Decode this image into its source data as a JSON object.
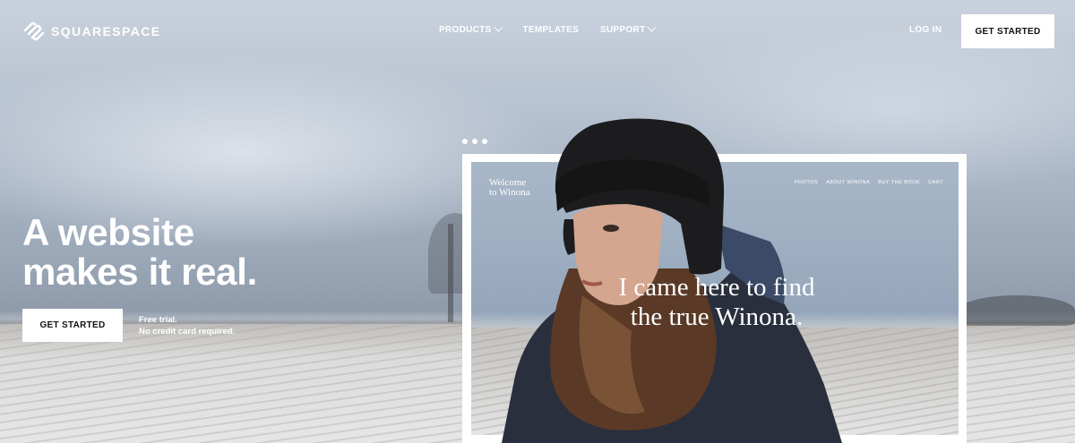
{
  "brand": {
    "name": "SQUARESPACE",
    "icon": "squarespace-logo-icon"
  },
  "nav": {
    "items": [
      {
        "label": "PRODUCTS",
        "has_dropdown": true
      },
      {
        "label": "TEMPLATES",
        "has_dropdown": false
      },
      {
        "label": "SUPPORT",
        "has_dropdown": true
      }
    ],
    "login_label": "LOG IN",
    "cta_label": "GET STARTED"
  },
  "hero": {
    "headline_line1": "A website",
    "headline_line2": "makes it real.",
    "cta_label": "GET STARTED",
    "trial_line1": "Free trial.",
    "trial_line2": "No credit card required."
  },
  "preview": {
    "site_title_line1": "Welcome",
    "site_title_line2": "to Winona",
    "nav": [
      "PHOTOS",
      "ABOUT WINONA",
      "BUY THE BOOK",
      "CART"
    ],
    "quote_line1": "I came here to find",
    "quote_line2": "the true Winona."
  },
  "colors": {
    "text_on_hero": "#ffffff",
    "button_bg": "#ffffff",
    "button_text": "#111111"
  }
}
